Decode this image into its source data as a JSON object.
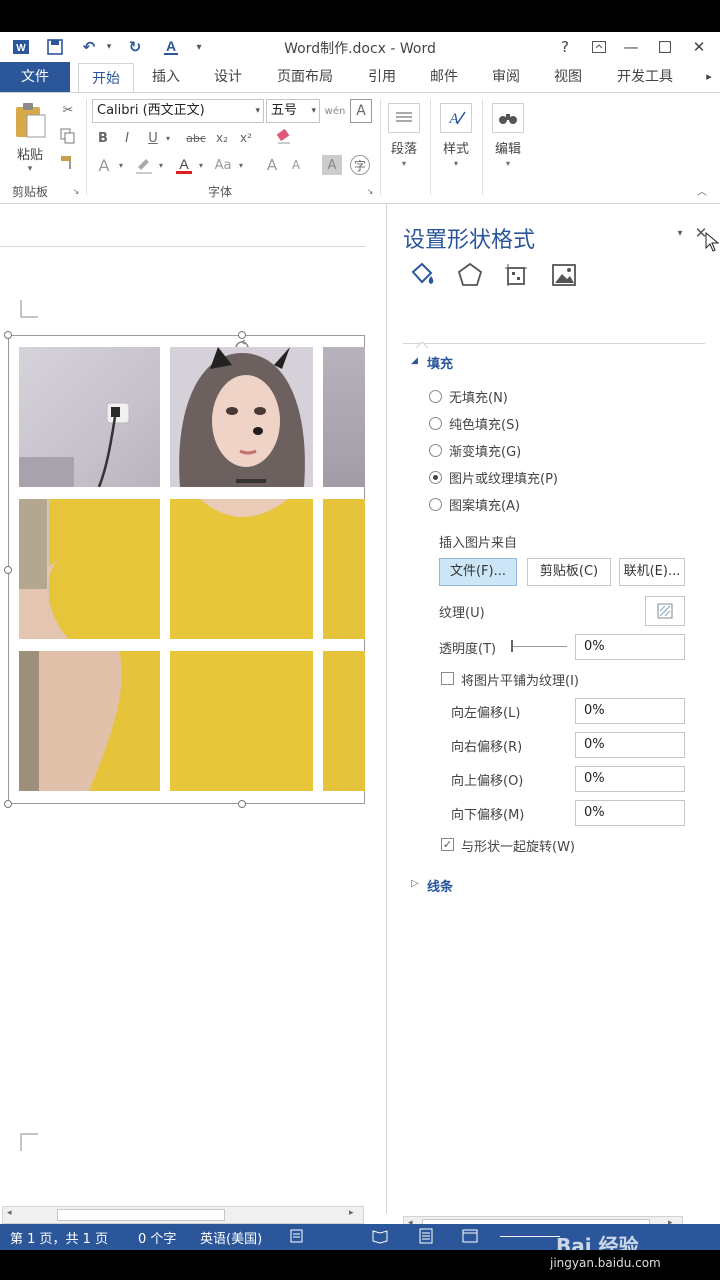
{
  "titlebar": {
    "doc_title": "Word制作.docx - Word",
    "help": "?",
    "minimize": "—",
    "close": "✕"
  },
  "tabs": [
    "文件",
    "开始",
    "插入",
    "设计",
    "页面布局",
    "引用",
    "邮件",
    "审阅",
    "视图",
    "开发工具"
  ],
  "ribbon": {
    "paste_label": "粘贴",
    "clipboard_group": "剪贴板",
    "font_name": "Calibri (西文正文)",
    "font_size": "五号",
    "font_group": "字体",
    "paragraph_label": "段落",
    "styles_label": "样式",
    "editing_label": "编辑",
    "bold": "B",
    "italic": "I",
    "underline": "U",
    "strike": "abc",
    "subscript": "x₂",
    "superscript": "x²",
    "grow": "A",
    "shrink": "A",
    "case": "Aa"
  },
  "pane": {
    "title": "设置形状格式",
    "fill_section": "填充",
    "fill_options": [
      {
        "label": "无填充(N)",
        "checked": false
      },
      {
        "label": "纯色填充(S)",
        "checked": false
      },
      {
        "label": "渐变填充(G)",
        "checked": false
      },
      {
        "label": "图片或纹理填充(P)",
        "checked": true
      },
      {
        "label": "图案填充(A)",
        "checked": false
      }
    ],
    "insert_from": "插入图片来自",
    "btn_file": "文件(F)...",
    "btn_clipboard": "剪贴板(C)",
    "btn_online": "联机(E)...",
    "texture_label": "纹理(U)",
    "transparency_label": "透明度(T)",
    "transparency_value": "0%",
    "tile_label": "将图片平铺为纹理(I)",
    "offset_left_label": "向左偏移(L)",
    "offset_left_value": "0%",
    "offset_right_label": "向右偏移(R)",
    "offset_right_value": "0%",
    "offset_up_label": "向上偏移(O)",
    "offset_up_value": "0%",
    "offset_down_label": "向下偏移(M)",
    "offset_down_value": "0%",
    "rotate_label": "与形状一起旋转(W)",
    "line_section": "线条"
  },
  "status": {
    "page": "第 1 页，共 1 页",
    "words": "0 个字",
    "language": "英语(美国)"
  },
  "watermark": {
    "brand": "Bai 经验",
    "url": "jingyan.baidu.com"
  },
  "colors": {
    "accent": "#2b579a",
    "tile_yellow": "#e7c63a"
  }
}
